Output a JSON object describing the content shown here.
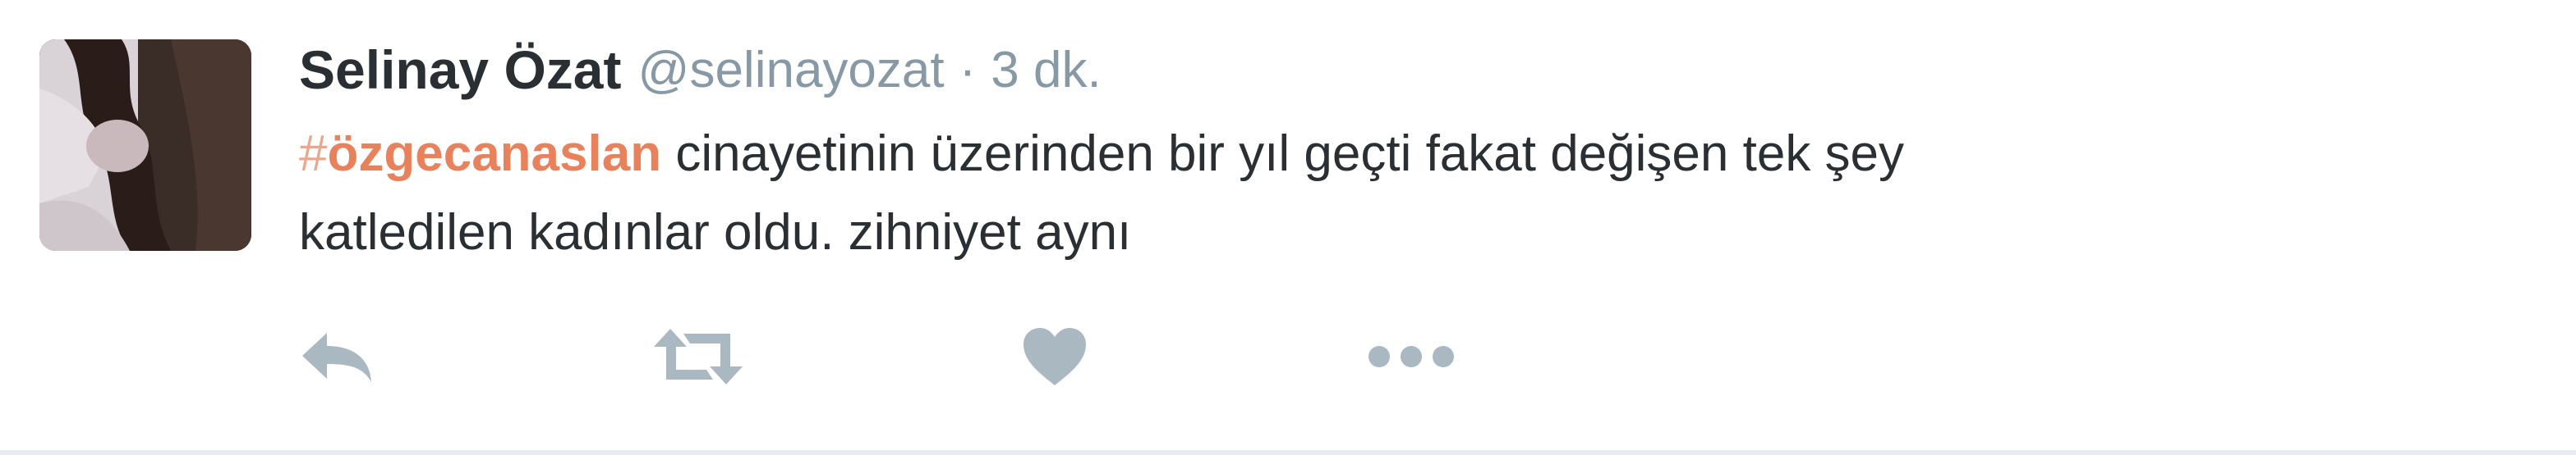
{
  "tweet": {
    "fullname": "Selinay Özat",
    "username": "@selinayozat",
    "separator": "·",
    "time": "3 dk.",
    "hash_symbol": "#",
    "hashtag": "özgecanaslan",
    "text_line1_rest": " cinayetinin üzerinden bir yıl geçti fakat değişen tek şey",
    "text_line2": "katledilen kadınlar oldu. zihniyet aynı"
  },
  "actions": [
    {
      "name": "reply-icon"
    },
    {
      "name": "retweet-icon"
    },
    {
      "name": "heart-icon"
    },
    {
      "name": "more-icon"
    }
  ],
  "colors": {
    "hashtag": "#e8825c",
    "icon": "#aab8c2",
    "text": "#292f33",
    "secondary": "#8899a6"
  }
}
